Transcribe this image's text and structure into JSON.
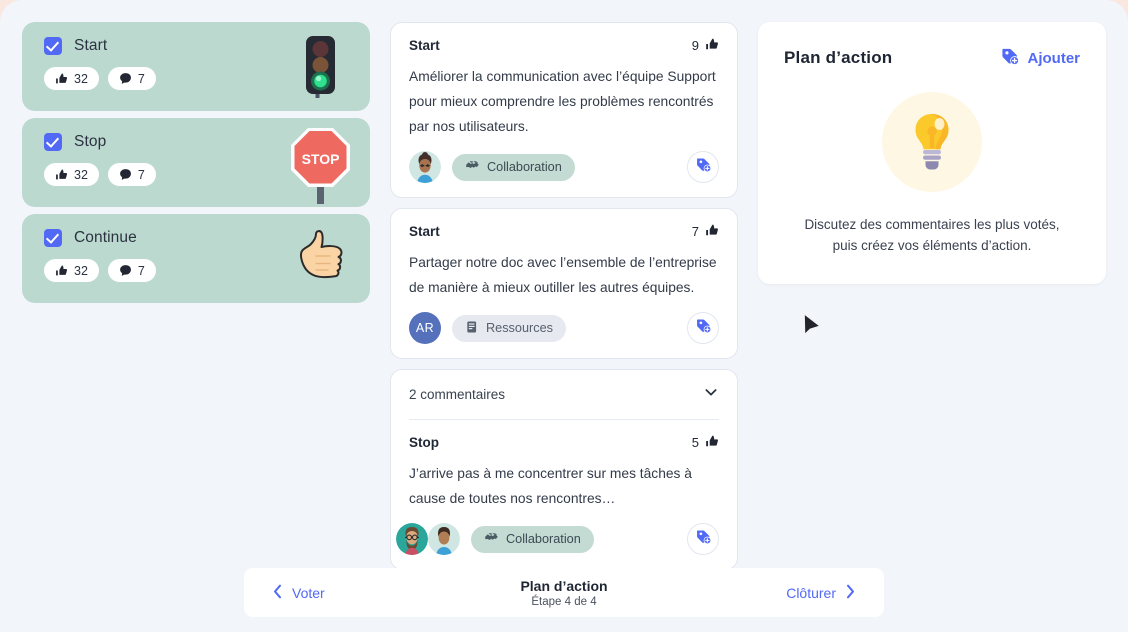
{
  "themes": [
    {
      "name": "Start",
      "checked": true,
      "votes": "32",
      "comments": "7",
      "art": "traffic-light"
    },
    {
      "name": "Stop",
      "checked": true,
      "votes": "32",
      "comments": "7",
      "art": "stop-sign"
    },
    {
      "name": "Continue",
      "checked": true,
      "votes": "32",
      "comments": "7",
      "art": "thumbs-up-hand"
    }
  ],
  "feedback": [
    {
      "theme": "Start",
      "votes": "9",
      "text": "Améliorer la communication avec l’équipe Support pour mieux comprendre les problèmes rencontrés par nos utilisateurs.",
      "tag": "Collaboration",
      "tag_icon": "handshake-icon",
      "tag_style": "collab",
      "avatar_kind": "photo",
      "avatar_initials": ""
    },
    {
      "theme": "Start",
      "votes": "7",
      "text": "Partager notre doc avec l’ensemble de l’entreprise de manière à mieux outiller les autres équipes.",
      "tag": "Ressources",
      "tag_icon": "book-icon",
      "tag_style": "res",
      "avatar_kind": "initials",
      "avatar_initials": "AR"
    }
  ],
  "comments_card": {
    "comments_label": "2 commentaires",
    "theme": "Stop",
    "votes": "5",
    "text": "J’arrive pas à me concentrer sur mes tâches à cause de toutes nos rencontres…",
    "tag": "Collaboration",
    "tag_icon": "handshake-icon",
    "tag_style": "collab"
  },
  "action_plan": {
    "title": "Plan d’action",
    "add_label": "Ajouter",
    "add_icon": "tag-plus-icon",
    "empty_icon": "lightbulb-icon",
    "description_line1": "Discutez des commentaires les plus votés,",
    "description_line2": "puis créez vos éléments d’action."
  },
  "footer": {
    "prev_label": "Voter",
    "prev_icon": "chevron-left-icon",
    "step_title": "Plan d’action",
    "step_subtitle": "Étape 4 de 4",
    "next_label": "Clôturer",
    "next_icon": "chevron-right-icon"
  },
  "colors": {
    "accent": "#5269f5",
    "theme_card_bg": "#bcd9d0",
    "page_bg": "#f2f5fa",
    "chip_collab": "#c3dbd3",
    "chip_res": "#e6e9ef"
  },
  "icons": {
    "thumbs_up": "thumbs-up-icon",
    "comment": "comment-bubble-icon",
    "chevron_down": "chevron-down-icon",
    "cursor": "mouse-pointer-icon"
  }
}
